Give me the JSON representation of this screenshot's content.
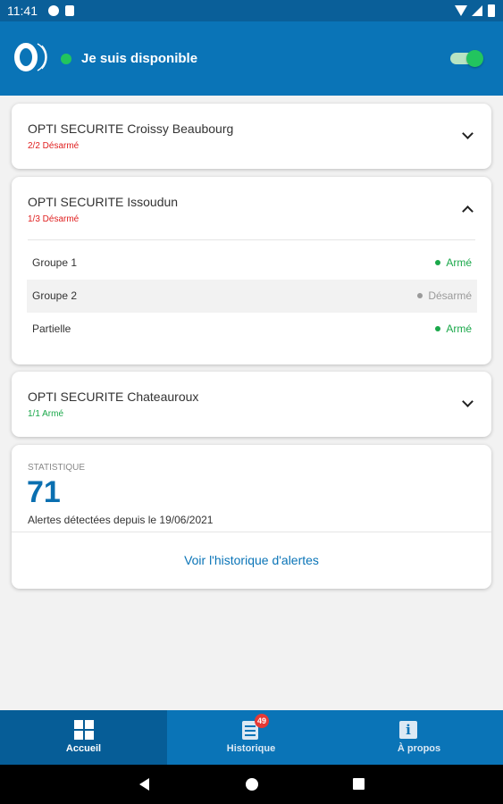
{
  "status_bar": {
    "time": "11:41"
  },
  "header": {
    "availability_label": "Je suis disponible",
    "toggle_on": true,
    "colors": {
      "bar": "#0a74b7",
      "status_dot": "#22c55e"
    }
  },
  "sites": [
    {
      "name": "OPTI SECURITE Croissy Beaubourg",
      "status": "2/2 Désarmé",
      "status_color": "#e02020",
      "expanded": false
    },
    {
      "name": "OPTI SECURITE Issoudun",
      "status": "1/3 Désarmé",
      "status_color": "#e02020",
      "expanded": true,
      "groups": [
        {
          "name": "Groupe 1",
          "state": "Armé",
          "state_color": "#1aa84a"
        },
        {
          "name": "Groupe 2",
          "state": "Désarmé",
          "state_color": "#9a9a9a"
        },
        {
          "name": "Partielle",
          "state": "Armé",
          "state_color": "#1aa84a"
        }
      ]
    },
    {
      "name": "OPTI SECURITE Chateauroux",
      "status": "1/1 Armé",
      "status_color": "#1aa84a",
      "expanded": false
    }
  ],
  "stats": {
    "label": "STATISTIQUE",
    "value": "71",
    "description": "Alertes détectées depuis le 19/06/2021",
    "link_label": "Voir l'historique d'alertes"
  },
  "bottom_nav": {
    "items": [
      {
        "label": "Accueil",
        "icon": "grid-icon",
        "active": true
      },
      {
        "label": "Historique",
        "icon": "list-icon",
        "badge": "49",
        "active": false
      },
      {
        "label": "À propos",
        "icon": "info-icon",
        "active": false
      }
    ]
  }
}
